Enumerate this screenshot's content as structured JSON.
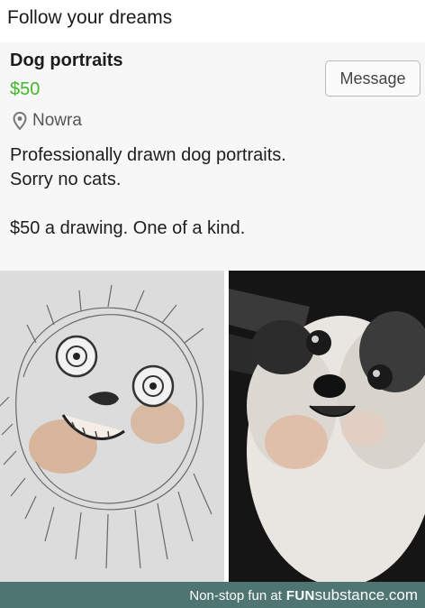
{
  "caption": "Follow your dreams",
  "listing": {
    "title": "Dog portraits",
    "price": "$50",
    "location": "Nowra",
    "message_button": "Message",
    "description_lines": [
      "Professionally drawn dog portraits.",
      "Sorry no cats.",
      "$50 a drawing. One of a kind."
    ]
  },
  "images": {
    "drawing": "pencil-drawing-of-dog",
    "photo": "shih-tzu-dog-photo"
  },
  "footer": {
    "tagline": "Non-stop fun at",
    "brand_fun": "FUN",
    "brand_substance": "substance.com"
  },
  "colors": {
    "price": "#42b72a",
    "footer_bg": "#4f7573",
    "listing_bg": "#f7f7f7"
  },
  "icons": [
    "location-pin-icon"
  ]
}
